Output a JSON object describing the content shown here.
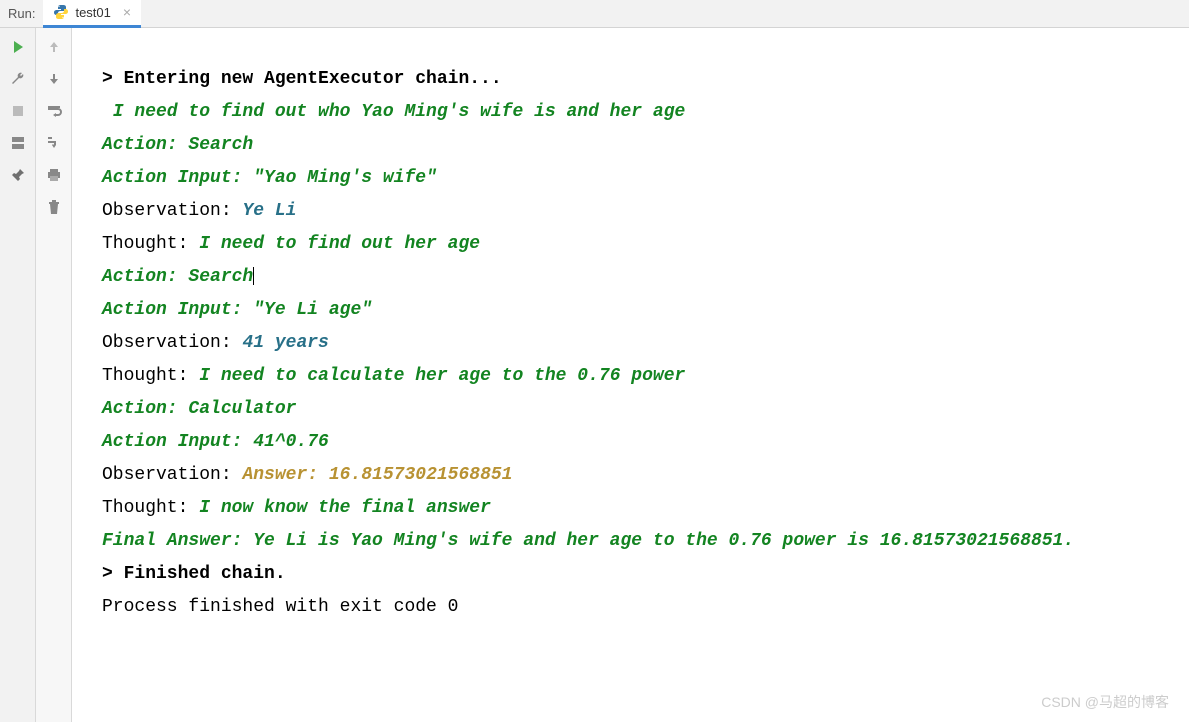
{
  "header": {
    "run_label": "Run:",
    "tab_name": "test01"
  },
  "console": {
    "lines": [
      {
        "segments": [
          {
            "text": "> Entering new AgentExecutor chain...",
            "class": "bold"
          }
        ]
      },
      {
        "segments": [
          {
            "text": " I need to find out who Yao Ming's wife is and her age",
            "class": "green-italic"
          }
        ]
      },
      {
        "segments": [
          {
            "text": "Action: Search",
            "class": "green-italic"
          }
        ]
      },
      {
        "segments": [
          {
            "text": "Action Input: \"Yao Ming's wife\"",
            "class": "green-italic"
          }
        ]
      },
      {
        "segments": [
          {
            "text": "Observation: ",
            "class": "plain"
          },
          {
            "text": "Ye Li",
            "class": "blue-italic"
          }
        ]
      },
      {
        "segments": [
          {
            "text": "Thought:",
            "class": "plain"
          },
          {
            "text": " I need to find out her age",
            "class": "green-italic"
          }
        ]
      },
      {
        "segments": [
          {
            "text": "Action: Search",
            "class": "green-italic"
          }
        ],
        "cursor": true
      },
      {
        "segments": [
          {
            "text": "Action Input: \"Ye Li age\"",
            "class": "green-italic"
          }
        ]
      },
      {
        "segments": [
          {
            "text": "Observation: ",
            "class": "plain"
          },
          {
            "text": "41 years",
            "class": "blue-italic"
          }
        ]
      },
      {
        "segments": [
          {
            "text": "Thought:",
            "class": "plain"
          },
          {
            "text": " I need to calculate her age to the 0.76 power",
            "class": "green-italic"
          }
        ]
      },
      {
        "segments": [
          {
            "text": "Action: Calculator",
            "class": "green-italic"
          }
        ]
      },
      {
        "segments": [
          {
            "text": "Action Input: 41^0.76",
            "class": "green-italic"
          }
        ]
      },
      {
        "segments": [
          {
            "text": "Observation: ",
            "class": "plain"
          },
          {
            "text": "Answer: 16.81573021568851",
            "class": "yellow-italic"
          }
        ]
      },
      {
        "segments": [
          {
            "text": "Thought:",
            "class": "plain"
          },
          {
            "text": " I now know the final answer",
            "class": "green-italic"
          }
        ]
      },
      {
        "segments": [
          {
            "text": "Final Answer: Ye Li is Yao Ming's wife and her age to the 0.76 power is 16.81573021568851.",
            "class": "green-italic"
          }
        ]
      },
      {
        "segments": [
          {
            "text": "",
            "class": "plain"
          }
        ]
      },
      {
        "segments": [
          {
            "text": "> Finished chain.",
            "class": "bold"
          }
        ]
      },
      {
        "segments": [
          {
            "text": "",
            "class": "plain"
          }
        ]
      },
      {
        "segments": [
          {
            "text": "",
            "class": "plain"
          }
        ]
      },
      {
        "segments": [
          {
            "text": "Process finished with exit code 0",
            "class": "plain"
          }
        ]
      }
    ]
  },
  "watermark": "CSDN @马超的博客"
}
